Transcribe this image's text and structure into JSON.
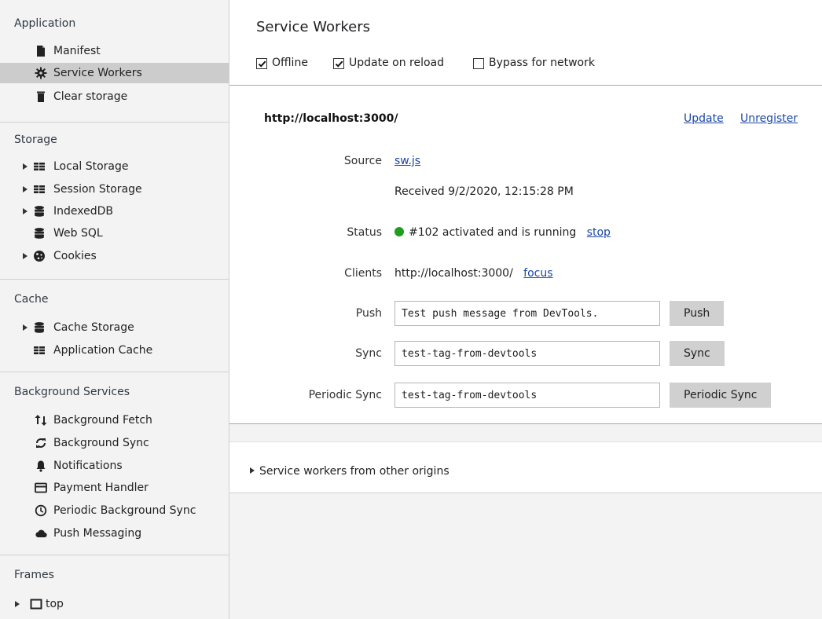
{
  "sidebar": {
    "application": {
      "title": "Application",
      "items": [
        {
          "label": "Manifest",
          "icon": "document-icon"
        },
        {
          "label": "Service Workers",
          "icon": "gear-icon",
          "selected": true
        },
        {
          "label": "Clear storage",
          "icon": "trash-icon"
        }
      ]
    },
    "storage": {
      "title": "Storage",
      "items": [
        {
          "label": "Local Storage",
          "icon": "grid-icon",
          "expandable": true
        },
        {
          "label": "Session Storage",
          "icon": "grid-icon",
          "expandable": true
        },
        {
          "label": "IndexedDB",
          "icon": "database-icon",
          "expandable": true
        },
        {
          "label": "Web SQL",
          "icon": "database-icon",
          "expandable": false
        },
        {
          "label": "Cookies",
          "icon": "cookie-icon",
          "expandable": true
        }
      ]
    },
    "cache": {
      "title": "Cache",
      "items": [
        {
          "label": "Cache Storage",
          "icon": "database-icon",
          "expandable": true
        },
        {
          "label": "Application Cache",
          "icon": "grid-icon",
          "expandable": false
        }
      ]
    },
    "background": {
      "title": "Background Services",
      "items": [
        {
          "label": "Background Fetch",
          "icon": "up-down-arrows-icon"
        },
        {
          "label": "Background Sync",
          "icon": "sync-icon"
        },
        {
          "label": "Notifications",
          "icon": "bell-icon"
        },
        {
          "label": "Payment Handler",
          "icon": "credit-card-icon"
        },
        {
          "label": "Periodic Background Sync",
          "icon": "clock-icon"
        },
        {
          "label": "Push Messaging",
          "icon": "cloud-icon"
        }
      ]
    },
    "frames": {
      "title": "Frames",
      "items": [
        {
          "label": "top",
          "icon": "frame-icon",
          "expandable": true
        }
      ]
    }
  },
  "main": {
    "title": "Service Workers",
    "options": [
      {
        "label": "Offline",
        "checked": true
      },
      {
        "label": "Update on reload",
        "checked": true
      },
      {
        "label": "Bypass for network",
        "checked": false
      }
    ],
    "origin": "http://localhost:3000/",
    "update_link": "Update",
    "unregister_link": "Unregister",
    "source_label": "Source",
    "source_link": "sw.js",
    "received": "Received 9/2/2020, 12:15:28 PM",
    "status_label": "Status",
    "status_text": "#102 activated and is running",
    "status_color": "#1e9e1e",
    "stop_link": "stop",
    "clients_label": "Clients",
    "clients_value": "http://localhost:3000/",
    "focus_link": "focus",
    "push_label": "Push",
    "push_value": "Test push message from DevTools.",
    "push_button": "Push",
    "sync_label": "Sync",
    "sync_value": "test-tag-from-devtools",
    "sync_button": "Sync",
    "periodic_label": "Periodic Sync",
    "periodic_value": "test-tag-from-devtools",
    "periodic_button": "Periodic Sync",
    "other_origins": "Service workers from other origins"
  }
}
